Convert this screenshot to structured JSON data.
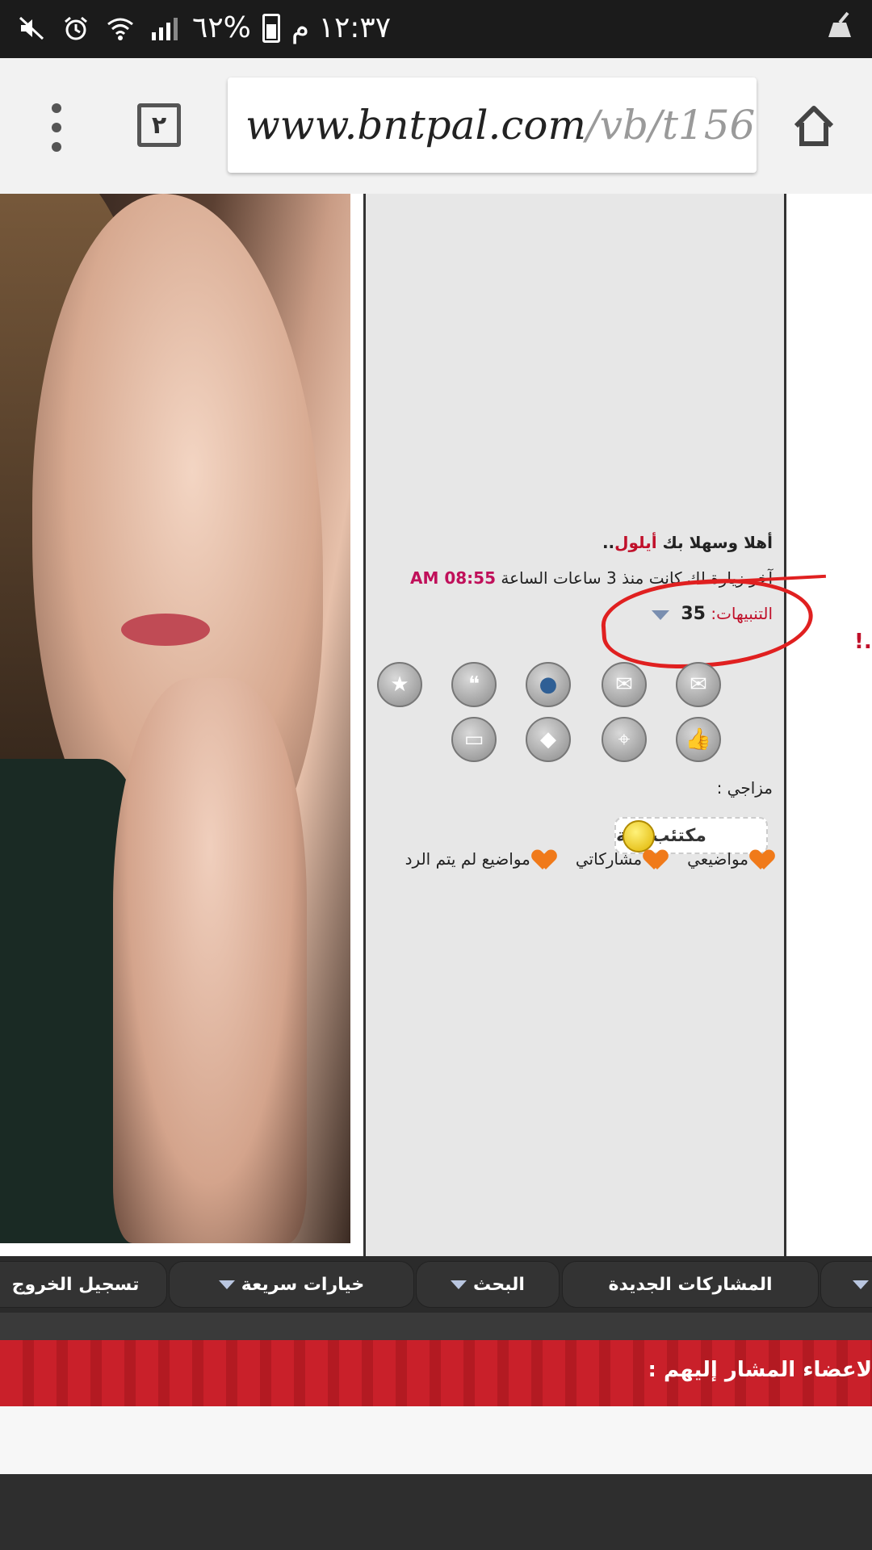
{
  "status_bar": {
    "time": "١٢:٣٧ م",
    "battery": "%٦٢"
  },
  "browser": {
    "tab_count": "٢",
    "url_domain": "www.bntpal.com",
    "url_path": "/vb/t156"
  },
  "panel": {
    "welcome_prefix": "أهلا وسهلا بك",
    "username": "أيلول",
    "welcome_suffix": "..",
    "last_visit": "آخر زيارة لك كانت منذ 3 ساعات الساعة",
    "last_visit_time": "AM 08:55",
    "alerts_label": "التنبيهات:",
    "alerts_count": "35",
    "mood_label": "مزاجي :",
    "mood_value": "مكتئب / ـة",
    "links": [
      "مواضيعي",
      "مشاركاتي",
      "مواضيع لم يتم الرد"
    ],
    "icons_row1": [
      "inbox-icon",
      "mail-icon",
      "profile-icon",
      "chat-icon",
      "star-icon"
    ],
    "icons_row2": [
      "like-icon",
      "location-icon",
      "tag-icon",
      "comment-icon"
    ]
  },
  "side_mark": "!..",
  "navbar": {
    "new_posts": "المشاركات الجديدة",
    "search": "البحث",
    "quick_options": "خيارات سريعة",
    "logout": "تسجيل الخروج"
  },
  "red_banner": "لاعضاء المشار إليهم :"
}
